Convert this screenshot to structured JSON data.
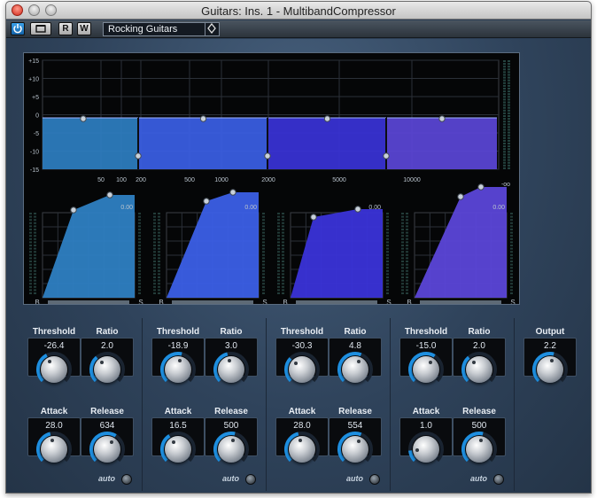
{
  "window": {
    "title": "Guitars: Ins. 1 - MultibandCompressor"
  },
  "toolbar": {
    "power_icon": "power-icon",
    "bypass_icon": "bypass-icon",
    "read_label": "R",
    "write_label": "W",
    "preset_value": "Rocking Guitars",
    "preset_menu_icon": "chevron-menu-icon"
  },
  "freq_display": {
    "y_ticks": [
      "+15",
      "+10",
      "+5",
      "0",
      "-5",
      "-10",
      "-15"
    ],
    "x_ticks": [
      "50",
      "100",
      "200",
      "500",
      "1000",
      "2000",
      "5000",
      "10000"
    ],
    "meter_min_label": "-oo",
    "band_colors": [
      "#2e7fc2",
      "#3b5fe6",
      "#3a33d8",
      "#5b46d8"
    ]
  },
  "bands": [
    {
      "peak": "0.00",
      "threshold": "-26.4",
      "ratio": "2.0",
      "attack": "28.0",
      "release": "634",
      "threshold_level": 0.4,
      "ratio_level": 0.35,
      "attack_level": 0.45,
      "release_level": 0.62
    },
    {
      "peak": "0.00",
      "threshold": "-18.9",
      "ratio": "3.0",
      "attack": "16.5",
      "release": "500",
      "threshold_level": 0.55,
      "ratio_level": 0.45,
      "attack_level": 0.38,
      "release_level": 0.55
    },
    {
      "peak": "0.00",
      "threshold": "-30.3",
      "ratio": "4.8",
      "attack": "28.0",
      "release": "554",
      "threshold_level": 0.33,
      "ratio_level": 0.58,
      "attack_level": 0.45,
      "release_level": 0.58
    },
    {
      "peak": "0.00",
      "threshold": "-15.0",
      "ratio": "2.0",
      "attack": "1.0",
      "release": "500",
      "threshold_level": 0.62,
      "ratio_level": 0.35,
      "attack_level": 0.15,
      "release_level": 0.55
    }
  ],
  "labels": {
    "threshold": "Threshold",
    "ratio": "Ratio",
    "attack": "Attack",
    "release": "Release",
    "auto": "auto",
    "output": "Output"
  },
  "output": {
    "value": "2.2",
    "level": 0.55
  },
  "graph_axis": {
    "min_label": "B",
    "max_label": "S"
  }
}
